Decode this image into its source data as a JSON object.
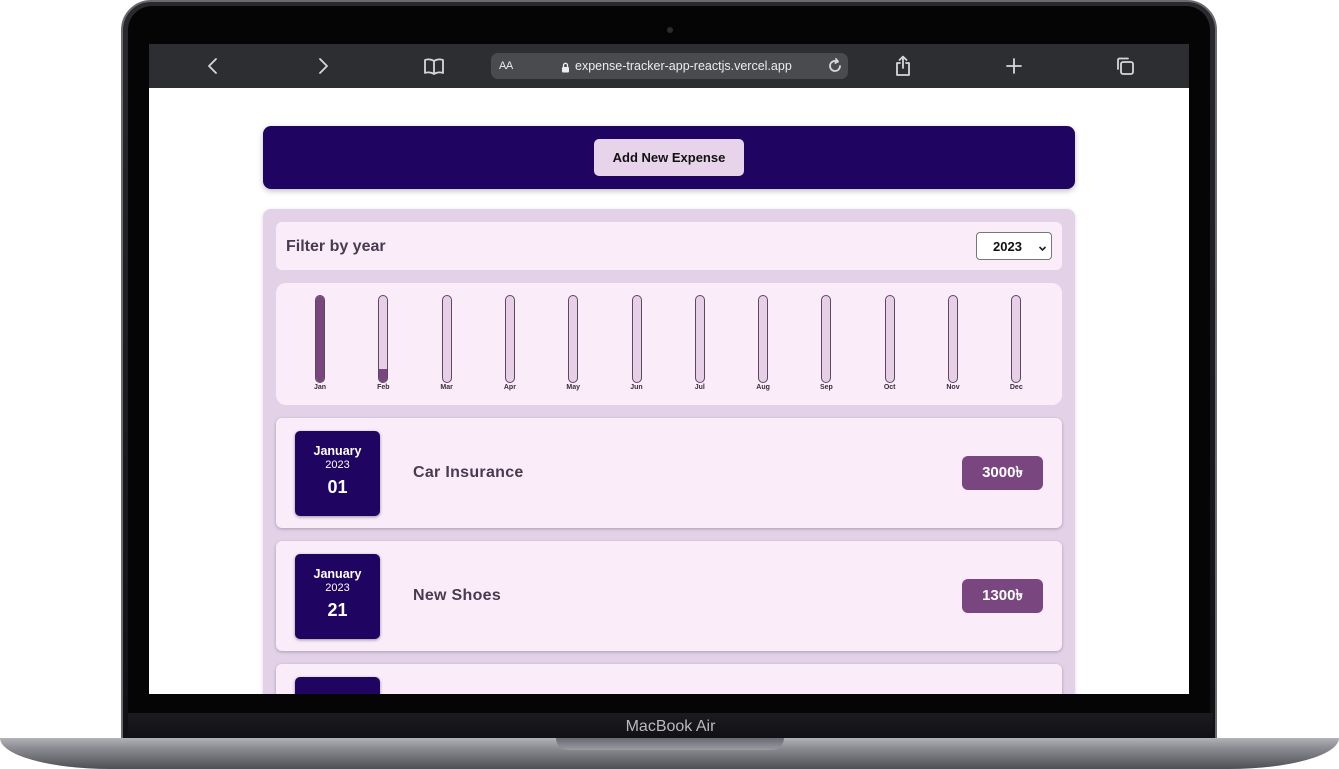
{
  "browser": {
    "text_size_label": "AA",
    "url": "expense-tracker-app-reactjs.vercel.app"
  },
  "device": {
    "label": "MacBook Air"
  },
  "app": {
    "add_button_label": "Add New Expense",
    "filter_label": "Filter by year",
    "selected_year": "2023"
  },
  "chart_data": {
    "type": "bar",
    "categories": [
      "Jan",
      "Feb",
      "Mar",
      "Apr",
      "May",
      "Jun",
      "Jul",
      "Aug",
      "Sep",
      "Oct",
      "Nov",
      "Dec"
    ],
    "values": [
      1.0,
      0.15,
      0,
      0,
      0,
      0,
      0,
      0,
      0,
      0,
      0,
      0
    ]
  },
  "expenses": [
    {
      "month": "January",
      "year": "2023",
      "day": "01",
      "title": "Car Insurance",
      "amount": "3000৳"
    },
    {
      "month": "January",
      "year": "2023",
      "day": "21",
      "title": "New Shoes",
      "amount": "1300৳"
    },
    {
      "month": "",
      "year": "",
      "day": "",
      "title": "",
      "amount": ""
    }
  ],
  "colors": {
    "header_bg": "#1f0461",
    "accent": "#7a4680",
    "panel_bg": "#e3d1e7",
    "card_bg": "#faedf9"
  }
}
